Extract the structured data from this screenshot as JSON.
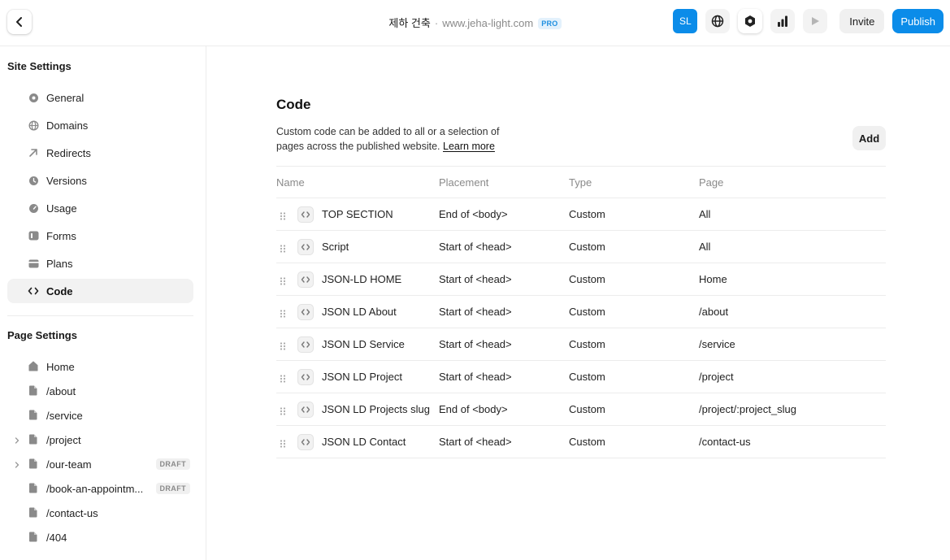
{
  "topbar": {
    "site_name": "제하 건축",
    "separator": "·",
    "url": "www.jeha-light.com",
    "plan_badge": "PRO",
    "avatar_initials": "SL",
    "invite_label": "Invite",
    "publish_label": "Publish",
    "accent_color": "#0b8ce9"
  },
  "sidebar": {
    "site_settings_title": "Site Settings",
    "site_items": [
      {
        "label": "General",
        "icon": "gear-icon"
      },
      {
        "label": "Domains",
        "icon": "globe-icon"
      },
      {
        "label": "Redirects",
        "icon": "arrow-up-right-icon"
      },
      {
        "label": "Versions",
        "icon": "clock-icon"
      },
      {
        "label": "Usage",
        "icon": "gauge-icon"
      },
      {
        "label": "Forms",
        "icon": "form-icon"
      },
      {
        "label": "Plans",
        "icon": "card-icon"
      },
      {
        "label": "Code",
        "icon": "code-icon",
        "active": true
      }
    ],
    "page_settings_title": "Page Settings",
    "pages": [
      {
        "label": "Home",
        "icon": "home-icon"
      },
      {
        "label": "/about",
        "icon": "page-icon"
      },
      {
        "label": "/service",
        "icon": "page-icon"
      },
      {
        "label": "/project",
        "icon": "page-icon",
        "expandable": true
      },
      {
        "label": "/our-team",
        "icon": "page-icon",
        "expandable": true,
        "badge": "DRAFT"
      },
      {
        "label": "/book-an-appointm...",
        "icon": "page-icon",
        "badge": "DRAFT"
      },
      {
        "label": "/contact-us",
        "icon": "page-icon"
      },
      {
        "label": "/404",
        "icon": "page-icon"
      }
    ]
  },
  "main": {
    "title": "Code",
    "description": "Custom code can be added to all or a selection of pages across the published website.",
    "learn_more": "Learn more",
    "add_label": "Add",
    "columns": [
      "Name",
      "Placement",
      "Type",
      "Page"
    ],
    "rows": [
      {
        "name": "TOP SECTION",
        "placement": "End of <body>",
        "type": "Custom",
        "page": "All"
      },
      {
        "name": "Script",
        "placement": "Start of <head>",
        "type": "Custom",
        "page": "All"
      },
      {
        "name": "JSON-LD HOME",
        "placement": "Start of <head>",
        "type": "Custom",
        "page": "Home"
      },
      {
        "name": "JSON LD About",
        "placement": "Start of <head>",
        "type": "Custom",
        "page": "/about"
      },
      {
        "name": "JSON LD Service",
        "placement": "Start of <head>",
        "type": "Custom",
        "page": "/service"
      },
      {
        "name": "JSON LD Project",
        "placement": "Start of <head>",
        "type": "Custom",
        "page": "/project"
      },
      {
        "name": "JSON LD Projects slug",
        "placement": "End of <body>",
        "type": "Custom",
        "page": "/project/:project_slug"
      },
      {
        "name": "JSON LD Contact",
        "placement": "Start of <head>",
        "type": "Custom",
        "page": "/contact-us"
      }
    ]
  }
}
